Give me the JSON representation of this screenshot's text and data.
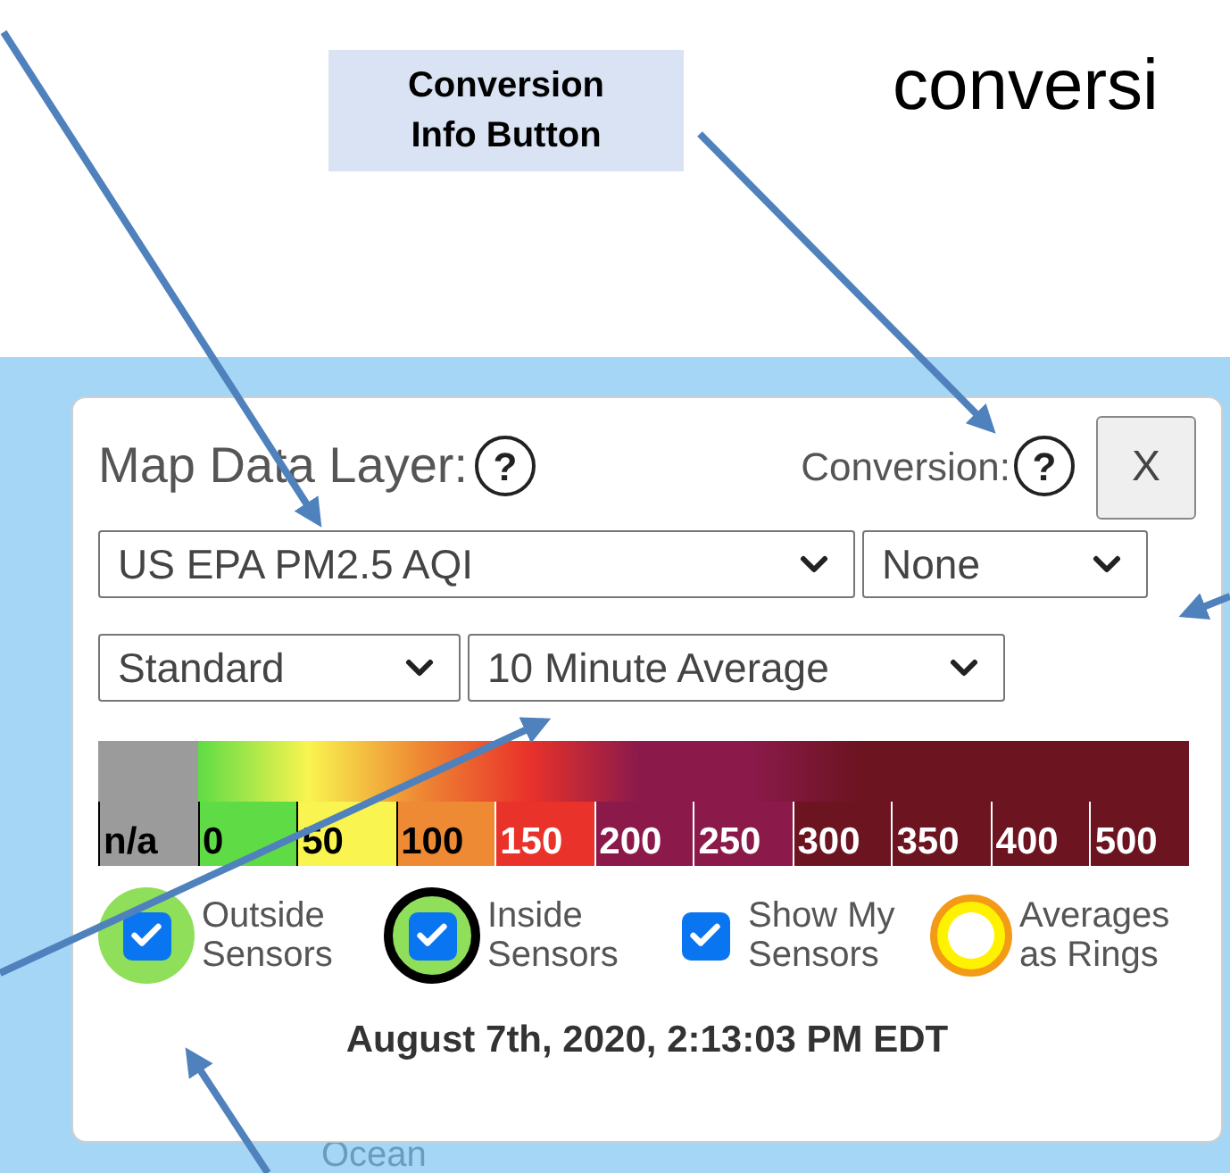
{
  "callout": {
    "text": "Conversion Info Button"
  },
  "heading_fragment": "conversi",
  "map_label": "Ocean",
  "panel": {
    "title": "Map Data Layer:",
    "help_icon_text": "?",
    "conversion_label": "Conversion:",
    "conversion_help_text": "?",
    "close_button": "X",
    "dropdowns_row_1": [
      {
        "value": "US EPA PM2.5 AQI",
        "kind": "wide"
      },
      {
        "value": "None",
        "kind": "narrow"
      }
    ],
    "dropdowns_row_2": [
      {
        "value": "Standard",
        "kind": "narrow"
      },
      {
        "value": "10 Minute Average",
        "kind": "wide"
      }
    ],
    "legend": [
      {
        "label": "n/a",
        "color": "#9b9b9b",
        "kind": "dark"
      },
      {
        "label": "0",
        "color": "#5fdc45",
        "kind": "dark"
      },
      {
        "label": "50",
        "color": "#f9f44f",
        "kind": "dark"
      },
      {
        "label": "100",
        "color": "#ee8a33",
        "kind": "dark"
      },
      {
        "label": "150",
        "color": "#e9322a",
        "kind": "light"
      },
      {
        "label": "200",
        "color": "#8b1a4b",
        "kind": "light"
      },
      {
        "label": "250",
        "color": "#8b1a4b",
        "kind": "light"
      },
      {
        "label": "300",
        "color": "#6d1421",
        "kind": "light"
      },
      {
        "label": "350",
        "color": "#6d1421",
        "kind": "light"
      },
      {
        "label": "400",
        "color": "#6d1421",
        "kind": "light"
      },
      {
        "label": "500",
        "color": "#6d1421",
        "kind": "light"
      }
    ],
    "options": [
      {
        "label": "Outside Sensors",
        "checked": true,
        "kind": "green-circle"
      },
      {
        "label": "Inside Sensors",
        "checked": true,
        "kind": "ringed-circle"
      },
      {
        "label": "Show My Sensors",
        "checked": true,
        "kind": "plain"
      },
      {
        "label": "Averages as Rings",
        "checked": false,
        "kind": "ring"
      }
    ],
    "timestamp": "August 7th, 2020, 2:13:03 PM EDT"
  }
}
